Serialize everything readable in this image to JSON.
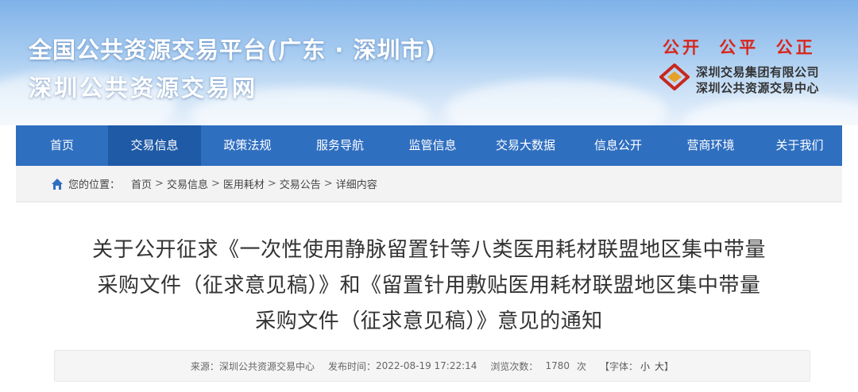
{
  "header": {
    "title_line1": "全国公共资源交易平台(广东 · 深圳市)",
    "title_line2": "深圳公共资源交易网",
    "slogan": "公开 公平 公正",
    "org_line1": "深圳交易集团有限公司",
    "org_line2": "深圳公共资源交易中心"
  },
  "nav": {
    "items": [
      {
        "label": "首页"
      },
      {
        "label": "交易信息"
      },
      {
        "label": "政策法规"
      },
      {
        "label": "服务导航"
      },
      {
        "label": "监管信息"
      },
      {
        "label": "交易大数据"
      },
      {
        "label": "信息公开"
      },
      {
        "label": "营商环境"
      },
      {
        "label": "关于我们"
      }
    ],
    "active": "交易信息"
  },
  "breadcrumb": {
    "prefix": "您的位置：",
    "items": [
      "首页",
      "交易信息",
      "医用耗材",
      "交易公告",
      "详细内容"
    ],
    "separator": ">"
  },
  "article": {
    "title_lines": [
      "关于公开征求《一次性使用静脉留置针等八类医用耗材联盟地区集中带量",
      "采购文件（征求意见稿）》和《留置针用敷贴医用耗材联盟地区集中带量",
      "采购文件（征求意见稿）》意见的通知"
    ],
    "meta": {
      "source_label": "来源：",
      "source": "深圳公共资源交易中心",
      "time_label": "发布时间：",
      "time": "2022-08-19 17:22:14",
      "views_label": "浏览次数：",
      "views": "1780",
      "views_unit": "次",
      "font_open": "【字体：",
      "font_small": "小",
      "font_large": "大",
      "font_close": "】"
    }
  },
  "colors": {
    "nav_bg": "#2f6fc0",
    "nav_active": "#1f5aa6",
    "slogan": "#d9261c"
  }
}
